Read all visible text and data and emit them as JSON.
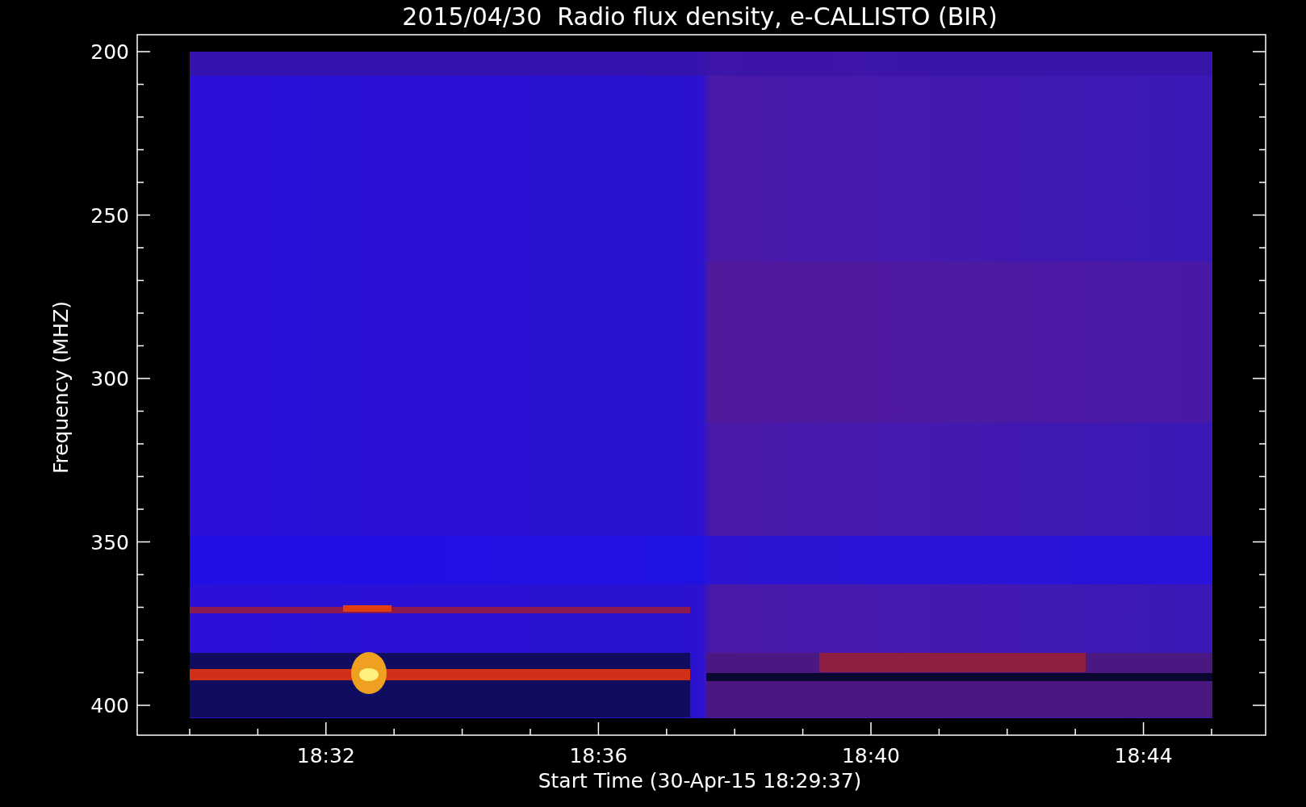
{
  "title": "2015/04/30  Radio flux density, e-CALLISTO (BIR)",
  "y_axis": {
    "label": "Frequency (MHZ)",
    "ticks": [
      "200",
      "250",
      "300",
      "350",
      "400"
    ]
  },
  "x_axis": {
    "label": "Start Time (30-Apr-15 18:29:37)",
    "ticks": [
      "18:32",
      "18:36",
      "18:40",
      "18:44"
    ]
  }
}
